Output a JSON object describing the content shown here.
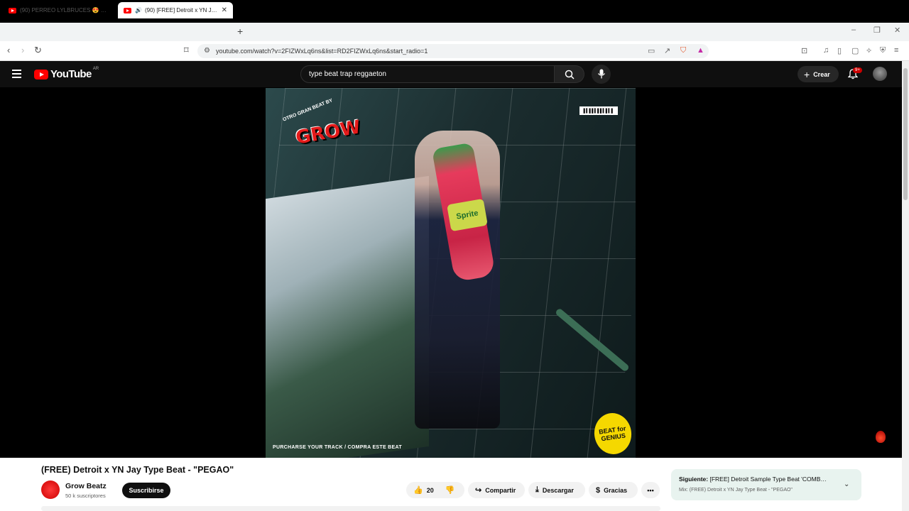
{
  "browser": {
    "tabs": [
      {
        "label": "(90) PERREO LYLBRUCES 😍 – Brunoo…",
        "active": false
      },
      {
        "label": "(90) [FREE] Detroit x YN Jay T…",
        "active": true
      }
    ],
    "url": "youtube.com/watch?v=2FIZWxLq6ns&list=RD2FIZWxLq6ns&start_radio=1"
  },
  "youtube": {
    "logo": "YouTube",
    "country": "AR",
    "search_value": "type beat trap reggaeton",
    "create_label": "Crear",
    "notif_badge": "9+"
  },
  "video_art": {
    "logo_text": "GROW",
    "logo_small": "OTRO GRAN BEAT BY",
    "caption": "PURCHARSE YOUR TRACK / COMPRA ESTE BEAT",
    "badge": "BEAT for GENIUS",
    "bottle_label": "Sprite"
  },
  "video": {
    "title": "(FREE) Detroit x YN Jay Type Beat - \"PEGAO\"",
    "channel": "Grow Beatz",
    "subscribers": "50 k suscriptores",
    "subscribe_label": "Suscribirse",
    "likes": "20",
    "share_label": "Compartir",
    "download_label": "Descargar",
    "thanks_label": "Gracias"
  },
  "next": {
    "prefix": "Siguiente:",
    "title": "[FREE] Detroit Sample Type Beat 'COMB…",
    "mix": "Mix: (FREE) Detroit x YN Jay Type Beat - \"PEGAO\""
  }
}
